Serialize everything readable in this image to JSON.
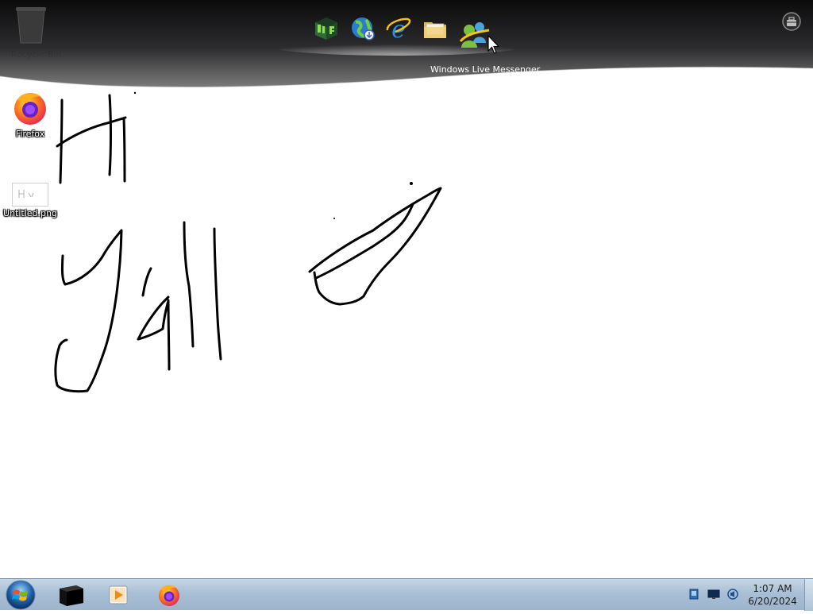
{
  "dock": {
    "tooltip": "Windows Live Messenger",
    "items": [
      {
        "name": "desktop-gadget-app",
        "icon": "green-cube-icon"
      },
      {
        "name": "windows-update-globe",
        "icon": "globe-icon"
      },
      {
        "name": "internet-explorer",
        "icon": "ie-icon"
      },
      {
        "name": "windows-explorer",
        "icon": "folder-icon"
      },
      {
        "name": "windows-live-messenger",
        "icon": "messenger-icon"
      }
    ],
    "recycle_bin_label": "Recycle Bin"
  },
  "desktop": {
    "icons": [
      {
        "label": "Firefox",
        "icon": "firefox-icon"
      },
      {
        "label": "Untitled.png",
        "icon": "image-file-icon"
      }
    ],
    "drawing_text": "Hi y'all"
  },
  "taskbar": {
    "start_icon": "windows-orb-icon",
    "pinned": [
      {
        "name": "terminal",
        "icon": "black-box-icon"
      },
      {
        "name": "media-player",
        "icon": "media-player-icon"
      },
      {
        "name": "firefox",
        "icon": "firefox-icon"
      }
    ],
    "tray": [
      "network-icon",
      "display-icon",
      "volume-icon"
    ],
    "clock": {
      "time": "1:07 AM",
      "date": "6/20/2024"
    }
  },
  "colors": {
    "dock_top": "#0f0f10",
    "dock_bottom": "#6f6f6f",
    "taskbar": "#a9bfd5",
    "ink": "#000000"
  }
}
